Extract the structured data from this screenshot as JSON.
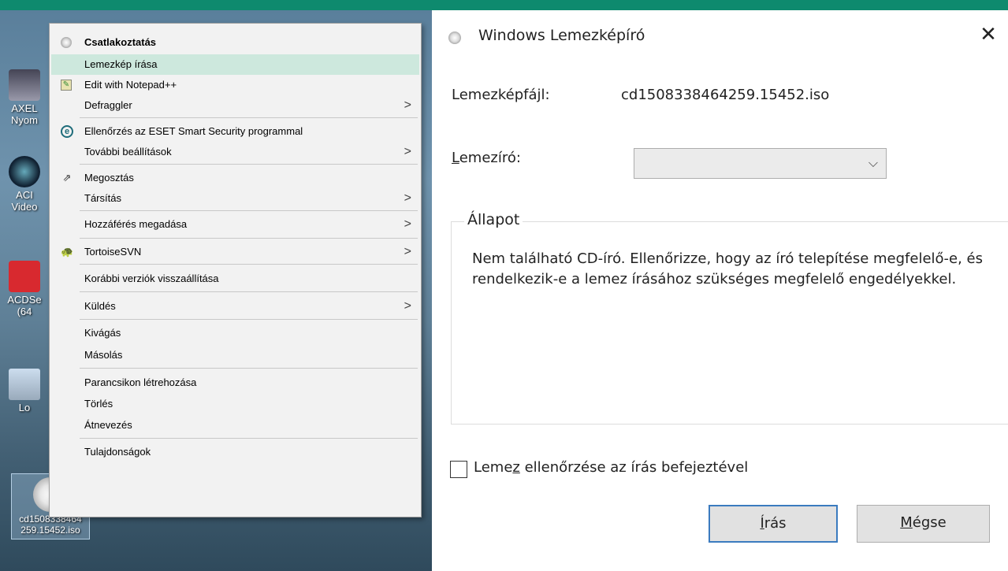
{
  "desktop": {
    "icons": [
      {
        "label": "AXEL\nNyom"
      },
      {
        "label": "ACI\nVideo"
      },
      {
        "label": "ACDSe\n(64"
      },
      {
        "label": "Lo"
      },
      {
        "label": "cd1508338464\n259.15452.iso"
      }
    ]
  },
  "context_menu": {
    "items": [
      {
        "label": "Csatlakoztatás",
        "icon": "disc-icon"
      },
      {
        "label": "Lemezkép írása"
      },
      {
        "label": "Edit with Notepad++",
        "icon": "notepad-icon"
      },
      {
        "label": "Defraggler"
      },
      {
        "label": "Ellenőrzés az ESET Smart Security programmal",
        "icon": "eset-icon"
      },
      {
        "label": "További beállítások"
      },
      {
        "label": "Megosztás",
        "icon": "share-icon"
      },
      {
        "label": "Társítás"
      },
      {
        "label": "Hozzáférés megadása"
      },
      {
        "label": "TortoiseSVN",
        "icon": "tortoise-icon"
      },
      {
        "label": "Korábbi verziók visszaállítása"
      },
      {
        "label": "Küldés"
      },
      {
        "label": "Kivágás"
      },
      {
        "label": "Másolás"
      },
      {
        "label": "Parancsikon létrehozása"
      },
      {
        "label": "Törlés"
      },
      {
        "label": "Átnevezés"
      },
      {
        "label": "Tulajdonságok"
      }
    ],
    "submenu_arrow": ">"
  },
  "dialog": {
    "title": "Windows Lemezképíró",
    "close_glyph": "✕",
    "image_file_label": "Lemezképfájl:",
    "image_file_value": "cd1508338464259.15452.iso",
    "burner_label_first": "L",
    "burner_label_rest": "emezíró:",
    "burner_value": "",
    "burner_chevron": "⌵",
    "status_legend": "Állapot",
    "status_text": "Nem található CD-író. Ellenőrizze, hogy az író telepítése megfelelő-e, és rendelkezik-e a lemez írásához szükséges megfelelő engedélyekkel.",
    "verify_checked": false,
    "verify_label_pre": "Leme",
    "verify_label_accel": "z",
    "verify_label_post": " ellenőrzése az írás befejeztével",
    "burn_button_accel": "Í",
    "burn_button_rest": "rás",
    "cancel_button_accel": "M",
    "cancel_button_rest": "égse",
    "accent_color": "#0e8a6e"
  }
}
